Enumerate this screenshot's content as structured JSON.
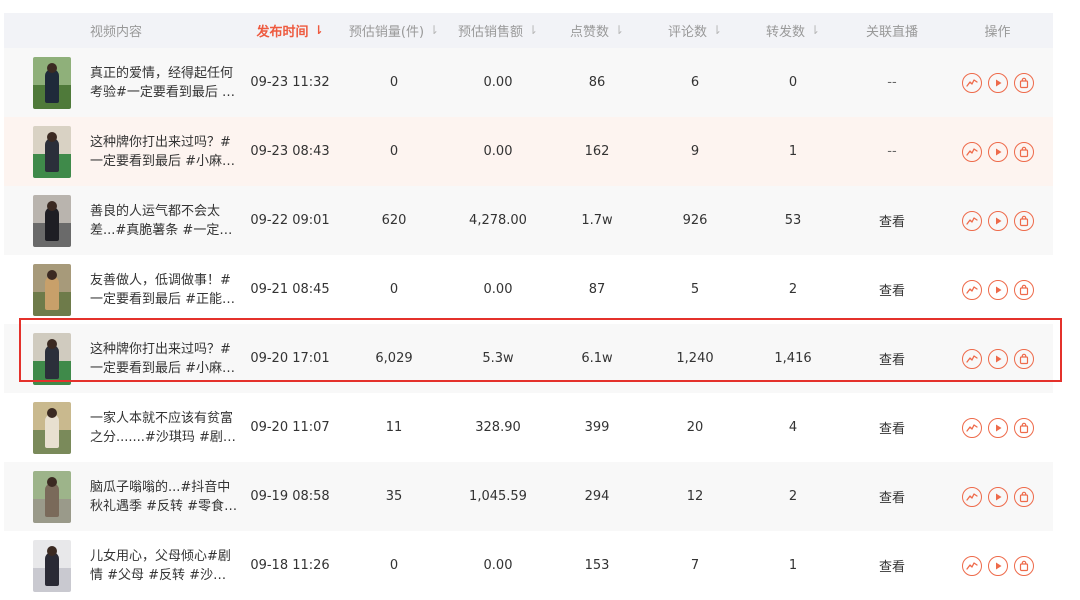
{
  "header": {
    "video_content": "视频内容",
    "publish_time": "发布时间",
    "est_sales_qty": "预估销量(件)",
    "est_sales_amount": "预估销售额",
    "likes": "点赞数",
    "comments": "评论数",
    "shares": "转发数",
    "related_live": "关联直播",
    "actions": "操作",
    "sort_icon": "sort-desc-icon"
  },
  "colors": {
    "accent": "#ee5a3f",
    "highlight_box": "#e4312b",
    "header_bg": "#f2f3f7",
    "row_hover_bg": "#fdf4f0"
  },
  "action_icons": [
    "trend-chart-icon",
    "play-icon",
    "shopping-bag-icon"
  ],
  "rows": [
    {
      "title": "真正的爱情，经得起任何考验#一定要看到最后 …",
      "time": "09-23 11:32",
      "qty": "0",
      "amount": "0.00",
      "likes": "86",
      "comments": "6",
      "shares": "0",
      "live": "--"
    },
    {
      "title": "这种牌你打出来过吗？#一定要看到最后 #小麻…",
      "time": "09-23 08:43",
      "qty": "0",
      "amount": "0.00",
      "likes": "162",
      "comments": "9",
      "shares": "1",
      "live": "--"
    },
    {
      "title": "善良的人运气都不会太差...#真脆薯条 #一定要…",
      "time": "09-22 09:01",
      "qty": "620",
      "amount": "4,278.00",
      "likes": "1.7w",
      "comments": "926",
      "shares": "53",
      "live": "查看"
    },
    {
      "title": "友善做人，低调做事！#一定要看到最后 #正能…",
      "time": "09-21 08:45",
      "qty": "0",
      "amount": "0.00",
      "likes": "87",
      "comments": "5",
      "shares": "2",
      "live": "查看"
    },
    {
      "title": "这种牌你打出来过吗？#一定要看到最后 #小麻…",
      "time": "09-20 17:01",
      "qty": "6,029",
      "amount": "5.3w",
      "likes": "6.1w",
      "comments": "1,240",
      "shares": "1,416",
      "live": "查看"
    },
    {
      "title": "一家人本就不应该有贫富之分.......#沙琪玛 #剧…",
      "time": "09-20 11:07",
      "qty": "11",
      "amount": "328.90",
      "likes": "399",
      "comments": "20",
      "shares": "4",
      "live": "查看"
    },
    {
      "title": "脑瓜子嗡嗡的...#抖音中秋礼遇季 #反转 #零食 …",
      "time": "09-19 08:58",
      "qty": "35",
      "amount": "1,045.59",
      "likes": "294",
      "comments": "12",
      "shares": "2",
      "live": "查看"
    },
    {
      "title": "儿女用心，父母倾心#剧情 #父母 #反转 #沙琪…",
      "time": "09-18 11:26",
      "qty": "0",
      "amount": "0.00",
      "likes": "153",
      "comments": "7",
      "shares": "1",
      "live": "查看"
    }
  ]
}
